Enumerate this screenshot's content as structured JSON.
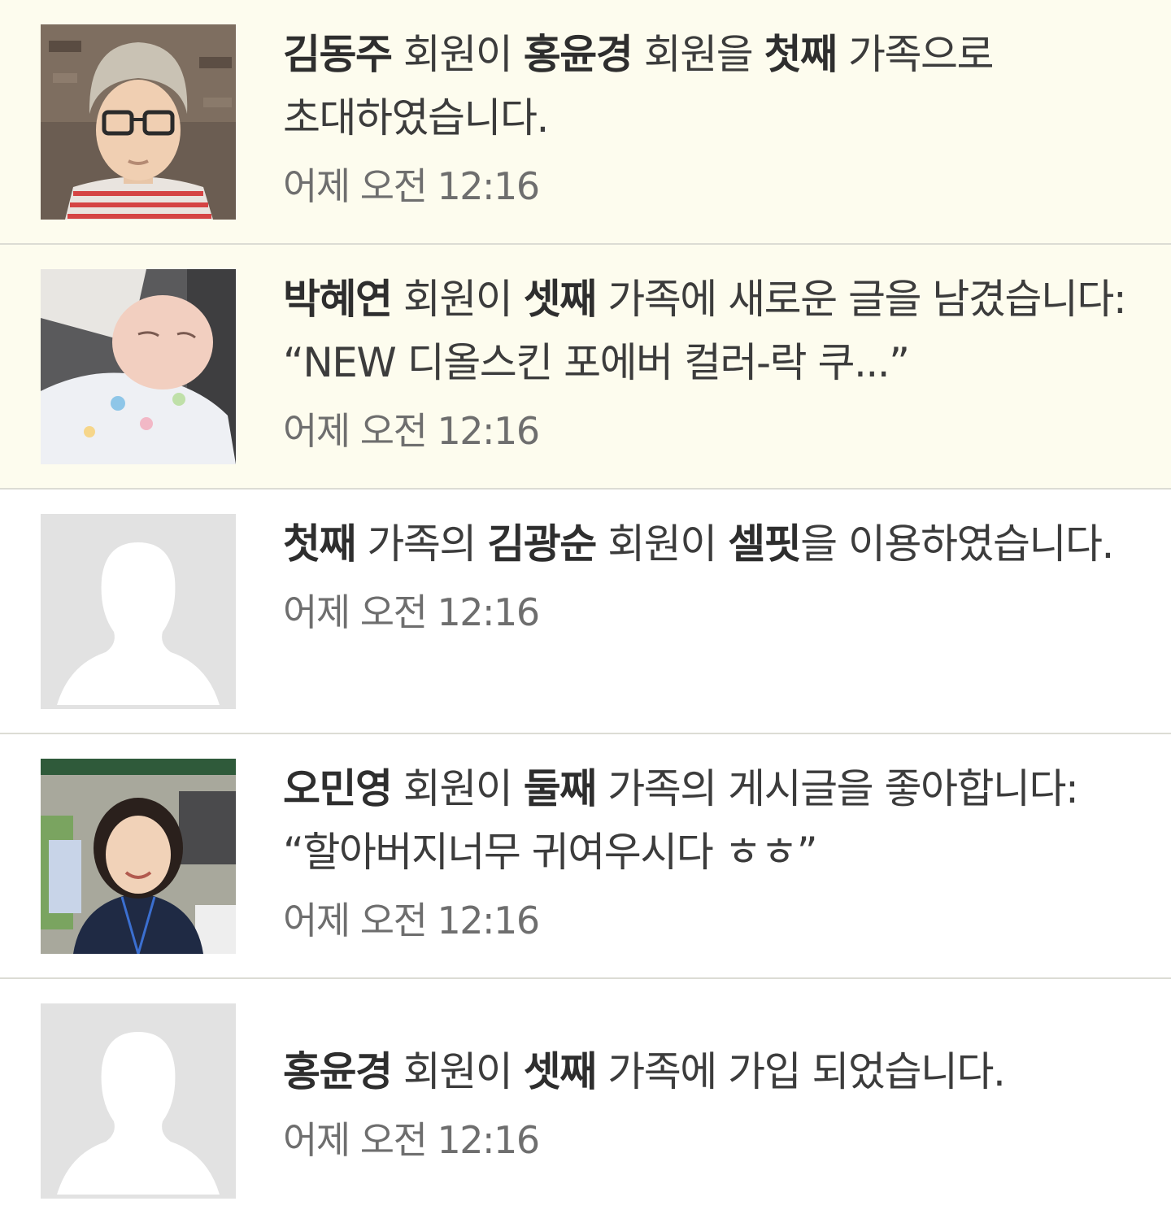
{
  "colors": {
    "unread_bg": "#fdfcee",
    "read_bg": "#ffffff",
    "divider": "#dcdcd4",
    "text": "#3c3c3c",
    "time": "#6e6e6e",
    "placeholder_avatar_bg": "#e2e2e2"
  },
  "notifications": [
    {
      "avatar": "photo-young-man-glasses",
      "unread": true,
      "actor": "김동주",
      "t1": " 회원이 ",
      "target": "홍윤경",
      "t2": " 회원을 ",
      "group": "첫째",
      "t3": " 가족으로 초대하였습니다.",
      "time": "어제 오전 12:16"
    },
    {
      "avatar": "photo-sleeping-baby",
      "unread": true,
      "actor": "박혜연",
      "t1": " 회원이 ",
      "group": "셋째",
      "t2": " 가족에 새로운 글을 남겼습니다: “NEW 디올스킨 포에버 컬러-락 쿠...”",
      "time": "어제 오전 12:16"
    },
    {
      "avatar": "default-person-icon",
      "unread": false,
      "group": "첫째",
      "t1": " 가족의 ",
      "actor": "김광순",
      "t2": " 회원이 ",
      "service": "셀핏",
      "t3": "을 이용하였습니다.",
      "time": "어제 오전 12:16"
    },
    {
      "avatar": "photo-smiling-woman",
      "unread": false,
      "actor": "오민영",
      "t1": " 회원이 ",
      "group": "둘째",
      "t2": " 가족의 게시글을 좋아합니다: “할아버지너무 귀여우시다 ㅎㅎ”",
      "time": "어제 오전 12:16"
    },
    {
      "avatar": "default-person-icon",
      "unread": false,
      "actor": "홍윤경",
      "t1": " 회원이 ",
      "group": "셋째",
      "t2": " 가족에 가입 되었습니다.",
      "time": "어제 오전 12:16"
    }
  ]
}
